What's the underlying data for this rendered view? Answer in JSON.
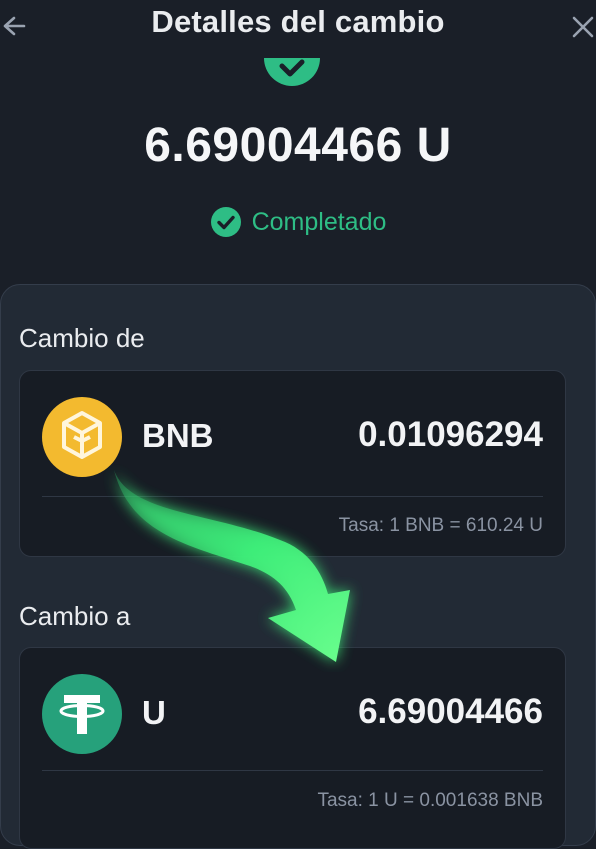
{
  "header": {
    "title": "Detalles del cambio"
  },
  "summary": {
    "amount": "6.69004466 U",
    "status": "Completado"
  },
  "from": {
    "label": "Cambio de",
    "coin": "BNB",
    "amount": "0.01096294",
    "rate": "Tasa: 1 BNB = 610.24 U"
  },
  "to": {
    "label": "Cambio a",
    "coin": "U",
    "amount": "6.69004466",
    "rate": "Tasa: 1 U = 0.001638 BNB"
  },
  "colors": {
    "background": "#1a1f28",
    "success": "#2ebd85",
    "bnb": "#f3ba2f",
    "tether": "#26a17b",
    "arrow": "#3ef07a"
  },
  "icons": [
    "back-arrow-icon",
    "close-icon",
    "check-circle-icon",
    "bnb-logo-icon",
    "tether-logo-icon",
    "curved-arrow-icon"
  ]
}
